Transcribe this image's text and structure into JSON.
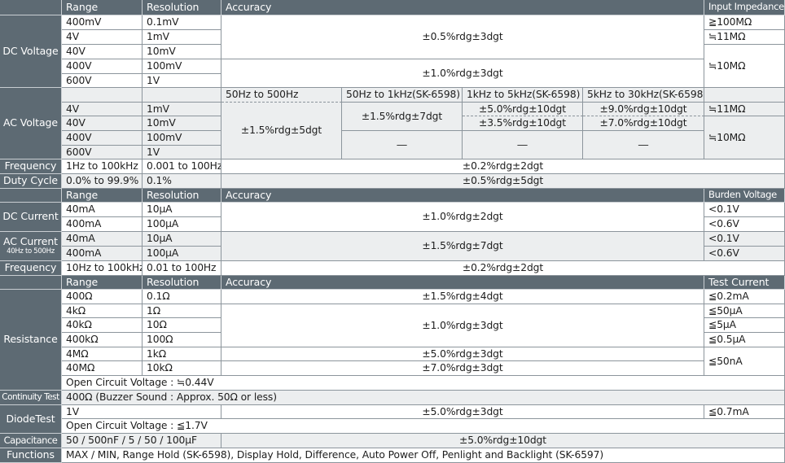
{
  "headers": {
    "range": "Range",
    "resolution": "Resolution",
    "accuracy": "Accuracy",
    "input_impedance": "Input Impedance",
    "burden_voltage": "Burden Voltage",
    "test_current": "Test Current"
  },
  "dc_voltage": {
    "label": "DC Voltage",
    "rows": [
      {
        "range": "400mV",
        "res": "0.1mV"
      },
      {
        "range": "4V",
        "res": "1mV"
      },
      {
        "range": "40V",
        "res": "10mV"
      },
      {
        "range": "400V",
        "res": "100mV"
      },
      {
        "range": "600V",
        "res": "1V"
      }
    ],
    "acc1": "±0.5%rdg±3dgt",
    "acc2": "±1.0%rdg±3dgt",
    "imp1": "≧100MΩ",
    "imp2": "≒11MΩ",
    "imp3": "≒10MΩ"
  },
  "ac_voltage": {
    "label": "AC Voltage",
    "bands": [
      "50Hz to 500Hz",
      "50Hz to 1kHz(SK-6598)",
      "1kHz to 5kHz(SK-6598)",
      "5kHz to 30kHz(SK-6598)"
    ],
    "rows": [
      {
        "range": "4V",
        "res": "1mV"
      },
      {
        "range": "40V",
        "res": "10mV"
      },
      {
        "range": "400V",
        "res": "100mV"
      },
      {
        "range": "600V",
        "res": "1V"
      }
    ],
    "acc_band1": "±1.5%rdg±5dgt",
    "acc_band2": "±1.5%rdg±7dgt",
    "acc_band3_a": "±5.0%rdg±10dgt",
    "acc_band3_b": "±3.5%rdg±10dgt",
    "acc_band4_a": "±9.0%rdg±10dgt",
    "acc_band4_b": "±7.0%rdg±10dgt",
    "na": "―",
    "imp1": "≒11MΩ",
    "imp2": "≒10MΩ"
  },
  "frequency_v": {
    "label": "Frequency",
    "range": "1Hz to 100kHz",
    "res": "0.001 to 100Hz",
    "acc": "±0.2%rdg±2dgt"
  },
  "duty_cycle": {
    "label": "Duty Cycle",
    "range": "0.0% to 99.9%",
    "res": "0.1%",
    "acc": "±0.5%rdg±5dgt"
  },
  "dc_current": {
    "label": "DC Current",
    "rows": [
      {
        "range": "40mA",
        "res": "10μA",
        "burden": "<0.1V"
      },
      {
        "range": "400mA",
        "res": "100μA",
        "burden": "<0.6V"
      }
    ],
    "acc": "±1.0%rdg±2dgt"
  },
  "ac_current": {
    "label": "AC Current",
    "sublabel": "40Hz to 500Hz",
    "rows": [
      {
        "range": "40mA",
        "res": "10μA",
        "burden": "<0.1V"
      },
      {
        "range": "400mA",
        "res": "100μA",
        "burden": "<0.6V"
      }
    ],
    "acc": "±1.5%rdg±7dgt"
  },
  "frequency_a": {
    "label": "Frequency",
    "range": "10Hz to 100kHz",
    "res": "0.01 to 100Hz",
    "acc": "±0.2%rdg±2dgt"
  },
  "resistance": {
    "label": "Resistance",
    "rows": [
      {
        "range": "400Ω",
        "res": "0.1Ω"
      },
      {
        "range": "4kΩ",
        "res": "1Ω"
      },
      {
        "range": "40kΩ",
        "res": "10Ω"
      },
      {
        "range": "400kΩ",
        "res": "100Ω"
      },
      {
        "range": "4MΩ",
        "res": "1kΩ"
      },
      {
        "range": "40MΩ",
        "res": "10kΩ"
      }
    ],
    "acc1": "±1.5%rdg±4dgt",
    "acc2": "±1.0%rdg±3dgt",
    "acc3": "±5.0%rdg±3dgt",
    "acc4": "±7.0%rdg±3dgt",
    "tc1": "≦0.2mA",
    "tc2": "≦50μA",
    "tc3": "≦5μA",
    "tc4": "≦0.5μA",
    "tc5": "≦50nA",
    "open_circuit": "Open Circuit Voltage : ≒0.44V"
  },
  "continuity": {
    "label": "Continuity Test",
    "value": "400Ω (Buzzer Sound : Approx. 50Ω or less)"
  },
  "diode": {
    "label": "DiodeTest",
    "range": "1V",
    "acc": "±5.0%rdg±3dgt",
    "tc": "≦0.7mA",
    "open_circuit": "Open Circuit Voltage : ≦1.7V"
  },
  "capacitance": {
    "label": "Capacitance",
    "range": "50 / 500nF / 5 / 50 / 100μF",
    "acc": "±5.0%rdg±10dgt"
  },
  "functions": {
    "label": "Functions",
    "value": "MAX / MIN, Range Hold (SK-6598), Display Hold, Difference, Auto Power Off, Penlight and Backlight (SK-6597)"
  }
}
